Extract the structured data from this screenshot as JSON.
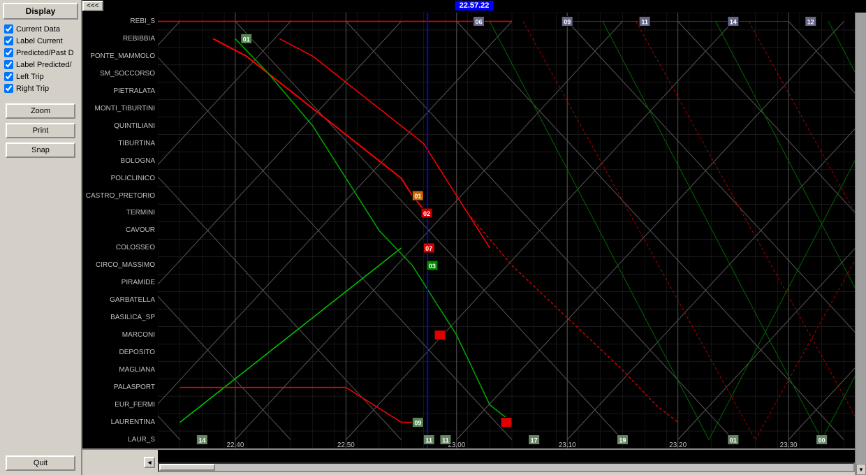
{
  "panel": {
    "title": "Display",
    "checkboxes": [
      {
        "id": "cb-current",
        "label": "Current Data",
        "checked": true
      },
      {
        "id": "cb-label-current",
        "label": "Label Current",
        "checked": true
      },
      {
        "id": "cb-predicted",
        "label": "Predicted/Past D",
        "checked": true
      },
      {
        "id": "cb-label-predicted",
        "label": "Label Predicted/",
        "checked": true
      },
      {
        "id": "cb-left-trip",
        "label": "Left Trip",
        "checked": true
      },
      {
        "id": "cb-right-trip",
        "label": "Right Trip",
        "checked": true
      }
    ],
    "buttons": [
      "Zoom",
      "Print",
      "Snap"
    ],
    "quit_label": "Quit"
  },
  "chart": {
    "time_indicator": "22.57.22",
    "nav_btn": "<<<",
    "stations": [
      "REBI_S",
      "REBIBBIA",
      "PONTE_MAMMOLO",
      "SM_SOCCORSO",
      "PIETRALATA",
      "MONTI_TIBURTINI",
      "QUINTILIANI",
      "TIBURTINA",
      "BOLOGNA",
      "POLICLINICO",
      "CASTRO_PRETORIO",
      "TERMINI",
      "CAVOUR",
      "COLOSSEO",
      "CIRCO_MASSIMO",
      "PIRAMIDE",
      "GARBATELLA",
      "BASILICA_SP",
      "MARCONI",
      "DEPOSITO",
      "MAGLIANA",
      "PALASPORT",
      "EUR_FERMI",
      "LAURENTINA",
      "LAUR_S"
    ],
    "time_labels": [
      "22.40",
      "22.50",
      "23.00",
      "23.10",
      "23.20",
      "23.30"
    ],
    "colors": {
      "background": "#000000",
      "grid": "#404040",
      "station_label": "#c0c0c0",
      "current_line": "#ff0000",
      "predicted_line": "#00cc00",
      "trip_line_gray": "#808080",
      "time_marker": "#0000ff",
      "badge_bg": "#0000ff",
      "badge_fg": "#ffffff"
    }
  }
}
